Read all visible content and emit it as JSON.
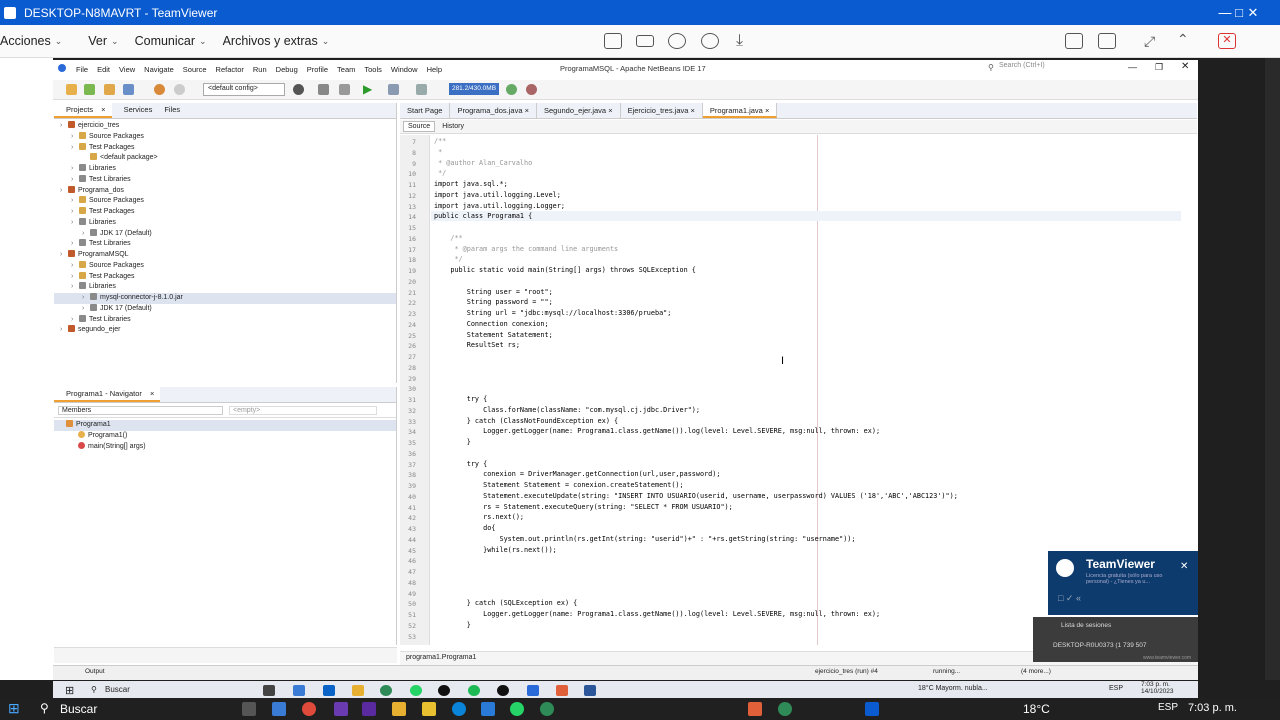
{
  "teamviewer": {
    "title": "DESKTOP-N8MAVRT - TeamViewer",
    "menu": [
      "Acciones",
      "Ver",
      "Comunicar",
      "Archivos y extras"
    ],
    "popup_title": "TeamViewer",
    "popup_sub": "Licencia gratuita (sólo para uso personal) - ¿Tienes ya u...",
    "sessions_label": "Lista de sesiones",
    "session_item": "DESKTOP-R0U0373 (1 739 507",
    "website": "www.teamviewer.com"
  },
  "netbeans": {
    "window_title": "ProgramaMSQL - Apache NetBeans IDE 17",
    "menu": [
      "File",
      "Edit",
      "View",
      "Navigate",
      "Source",
      "Refactor",
      "Run",
      "Debug",
      "Profile",
      "Team",
      "Tools",
      "Window",
      "Help"
    ],
    "config": "<default config>",
    "memory": "281.2/430.0MB",
    "search_placeholder": "Search (Ctrl+I)",
    "panel_tabs": [
      "Projects",
      "Services",
      "Files"
    ],
    "tree": [
      {
        "label": "ejercicio_tres",
        "lvl": 0,
        "type": "proj"
      },
      {
        "label": "Source Packages",
        "lvl": 1,
        "type": "pkg"
      },
      {
        "label": "Test Packages",
        "lvl": 1,
        "type": "pkg"
      },
      {
        "label": "<default package>",
        "lvl": 2,
        "type": "file"
      },
      {
        "label": "Libraries",
        "lvl": 1,
        "type": "lib"
      },
      {
        "label": "Test Libraries",
        "lvl": 1,
        "type": "lib"
      },
      {
        "label": "Programa_dos",
        "lvl": 0,
        "type": "proj"
      },
      {
        "label": "Source Packages",
        "lvl": 1,
        "type": "pkg"
      },
      {
        "label": "Test Packages",
        "lvl": 1,
        "type": "pkg"
      },
      {
        "label": "Libraries",
        "lvl": 1,
        "type": "lib"
      },
      {
        "label": "JDK 17 (Default)",
        "lvl": 2,
        "type": "lib"
      },
      {
        "label": "Test Libraries",
        "lvl": 1,
        "type": "lib"
      },
      {
        "label": "ProgramaMSQL",
        "lvl": 0,
        "type": "proj"
      },
      {
        "label": "Source Packages",
        "lvl": 1,
        "type": "pkg"
      },
      {
        "label": "Test Packages",
        "lvl": 1,
        "type": "pkg"
      },
      {
        "label": "Libraries",
        "lvl": 1,
        "type": "lib"
      },
      {
        "label": "mysql-connector-j-8.1.0.jar",
        "lvl": 2,
        "type": "lib",
        "sel": true
      },
      {
        "label": "JDK 17 (Default)",
        "lvl": 2,
        "type": "lib"
      },
      {
        "label": "Test Libraries",
        "lvl": 1,
        "type": "lib"
      },
      {
        "label": "segundo_ejer",
        "lvl": 0,
        "type": "proj"
      }
    ],
    "navigator_title": "Programa1 - Navigator",
    "navigator_filter": "Members",
    "navigator_empty": "<empty>",
    "navigator_items": [
      "Programa1",
      "Programa1()",
      "main(String[] args)"
    ],
    "editor_tabs": [
      "Start Page",
      "Programa_dos.java",
      "Segundo_ejer.java",
      "Ejercicio_tres.java",
      "Programa1.java"
    ],
    "editor_tool": [
      "Source",
      "History"
    ],
    "breadcrumb": "programa1.Programa1",
    "output_label": "Output",
    "run_status": "ejercicio_tres (run) #4",
    "running": "running...",
    "insert": "(4 more...)"
  },
  "code_lines": [
    {
      "n": "7",
      "t": "/**",
      "c": "cm"
    },
    {
      "n": "8",
      "t": " *",
      "c": "cm"
    },
    {
      "n": "9",
      "t": " * @author Alan_Carvalho",
      "c": "cm"
    },
    {
      "n": "10",
      "t": " */",
      "c": "cm"
    },
    {
      "n": "11",
      "t": "import java.sql.*;",
      "c": ""
    },
    {
      "n": "12",
      "t": "import java.util.logging.Level;",
      "c": ""
    },
    {
      "n": "13",
      "t": "import java.util.logging.Logger;",
      "c": ""
    },
    {
      "n": "14",
      "t": "public class Programa1 {",
      "c": ""
    },
    {
      "n": "15",
      "t": "",
      "c": ""
    },
    {
      "n": "16",
      "t": "    /**",
      "c": "cm"
    },
    {
      "n": "17",
      "t": "     * @param args the command line arguments",
      "c": "cm"
    },
    {
      "n": "18",
      "t": "     */",
      "c": "cm"
    },
    {
      "n": "19",
      "t": "    public static void main(String[] args) throws SQLException {",
      "c": ""
    },
    {
      "n": "20",
      "t": "",
      "c": ""
    },
    {
      "n": "21",
      "t": "        String user = \"root\";",
      "c": ""
    },
    {
      "n": "22",
      "t": "        String password = \"\";",
      "c": ""
    },
    {
      "n": "23",
      "t": "        String url = \"jdbc:mysql://localhost:3306/prueba\";",
      "c": ""
    },
    {
      "n": "24",
      "t": "        Connection conexion;",
      "c": ""
    },
    {
      "n": "25",
      "t": "        Statement Satatement;",
      "c": ""
    },
    {
      "n": "26",
      "t": "        ResultSet rs;",
      "c": ""
    },
    {
      "n": "27",
      "t": "",
      "c": ""
    },
    {
      "n": "28",
      "t": "",
      "c": ""
    },
    {
      "n": "29",
      "t": "",
      "c": ""
    },
    {
      "n": "30",
      "t": "",
      "c": ""
    },
    {
      "n": "31",
      "t": "        try {",
      "c": ""
    },
    {
      "n": "32",
      "t": "            Class.forName(className: \"com.mysql.cj.jdbc.Driver\");",
      "c": ""
    },
    {
      "n": "33",
      "t": "        } catch (ClassNotFoundException ex) {",
      "c": ""
    },
    {
      "n": "34",
      "t": "            Logger.getLogger(name: Programa1.class.getName()).log(level: Level.SEVERE, msg:null, thrown: ex);",
      "c": ""
    },
    {
      "n": "35",
      "t": "        }",
      "c": ""
    },
    {
      "n": "36",
      "t": "",
      "c": ""
    },
    {
      "n": "37",
      "t": "        try {",
      "c": ""
    },
    {
      "n": "38",
      "t": "            conexion = DriverManager.getConnection(url,user,password);",
      "c": ""
    },
    {
      "n": "39",
      "t": "            Statement Statement = conexion.createStatement();",
      "c": ""
    },
    {
      "n": "40",
      "t": "            Statement.executeUpdate(string: \"INSERT INTO USUARIO(userid, username, userpassword) VALUES ('18','ABC','ABC123')\");",
      "c": ""
    },
    {
      "n": "41",
      "t": "            rs = Statement.executeQuery(string: \"SELECT * FROM USUARIO\");",
      "c": ""
    },
    {
      "n": "42",
      "t": "            rs.next();",
      "c": ""
    },
    {
      "n": "43",
      "t": "            do{",
      "c": ""
    },
    {
      "n": "44",
      "t": "                System.out.println(rs.getInt(string: \"userid\")+\" : \"+rs.getString(string: \"username\"));",
      "c": ""
    },
    {
      "n": "45",
      "t": "            }while(rs.next());",
      "c": ""
    },
    {
      "n": "46",
      "t": "",
      "c": ""
    },
    {
      "n": "47",
      "t": "",
      "c": ""
    },
    {
      "n": "48",
      "t": "",
      "c": ""
    },
    {
      "n": "49",
      "t": "",
      "c": ""
    },
    {
      "n": "50",
      "t": "        } catch (SQLException ex) {",
      "c": ""
    },
    {
      "n": "51",
      "t": "            Logger.getLogger(name: Programa1.class.getName()).log(level: Level.SEVERE, msg:null, thrown: ex);",
      "c": ""
    },
    {
      "n": "52",
      "t": "        }",
      "c": ""
    },
    {
      "n": "53",
      "t": "",
      "c": ""
    }
  ],
  "inner_taskbar": {
    "search": "Buscar",
    "weather": "18°C  Mayorm. nubla...",
    "lang": "ESP",
    "time": "7:03 p. m.",
    "date": "14/10/2023"
  },
  "outer_taskbar": {
    "search": "Buscar",
    "weather": "18°C",
    "lang": "ESP",
    "time": "7:03 p. m."
  }
}
